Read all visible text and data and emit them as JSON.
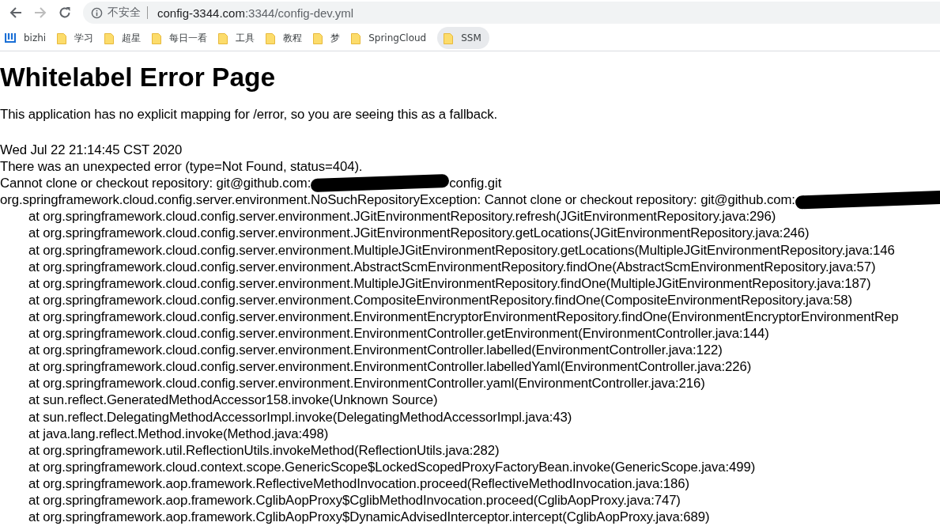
{
  "browser": {
    "back_disabled": false,
    "forward_disabled": true,
    "security_label": "不安全",
    "url_host": "config-3344.com",
    "url_path": ":3344/config-dev.yml"
  },
  "bookmarks": [
    {
      "label": "bizhi",
      "kind": "site",
      "selected": false
    },
    {
      "label": "学习",
      "kind": "folder",
      "selected": false
    },
    {
      "label": "超星",
      "kind": "folder",
      "selected": false
    },
    {
      "label": "每日一看",
      "kind": "folder",
      "selected": false
    },
    {
      "label": "工具",
      "kind": "folder",
      "selected": false
    },
    {
      "label": "教程",
      "kind": "folder",
      "selected": false
    },
    {
      "label": "梦",
      "kind": "folder",
      "selected": false
    },
    {
      "label": "SpringCloud",
      "kind": "folder",
      "selected": false
    },
    {
      "label": "SSM",
      "kind": "folder",
      "selected": true
    }
  ],
  "page": {
    "title": "Whitelabel Error Page",
    "message": "This application has no explicit mapping for /error, so you are seeing this as a fallback.",
    "lines": [
      {
        "text": "Wed Jul 22 21:14:45 CST 2020",
        "indented": false
      },
      {
        "text": "There was an unexpected error (type=Not Found, status=404).",
        "indented": false
      },
      {
        "text": "Cannot clone or checkout repository: git@github.com:",
        "indented": false,
        "redacted": true,
        "after": "config.git"
      },
      {
        "text": "org.springframework.cloud.config.server.environment.NoSuchRepositoryException: Cannot clone or checkout repository: git@github.com:",
        "indented": false,
        "redacted": true
      },
      {
        "text": "at org.springframework.cloud.config.server.environment.JGitEnvironmentRepository.refresh(JGitEnvironmentRepository.java:296)",
        "indented": true
      },
      {
        "text": "at org.springframework.cloud.config.server.environment.JGitEnvironmentRepository.getLocations(JGitEnvironmentRepository.java:246)",
        "indented": true
      },
      {
        "text": "at org.springframework.cloud.config.server.environment.MultipleJGitEnvironmentRepository.getLocations(MultipleJGitEnvironmentRepository.java:146",
        "indented": true
      },
      {
        "text": "at org.springframework.cloud.config.server.environment.AbstractScmEnvironmentRepository.findOne(AbstractScmEnvironmentRepository.java:57)",
        "indented": true
      },
      {
        "text": "at org.springframework.cloud.config.server.environment.MultipleJGitEnvironmentRepository.findOne(MultipleJGitEnvironmentRepository.java:187)",
        "indented": true
      },
      {
        "text": "at org.springframework.cloud.config.server.environment.CompositeEnvironmentRepository.findOne(CompositeEnvironmentRepository.java:58)",
        "indented": true
      },
      {
        "text": "at org.springframework.cloud.config.server.environment.EnvironmentEncryptorEnvironmentRepository.findOne(EnvironmentEncryptorEnvironmentRep",
        "indented": true
      },
      {
        "text": "at org.springframework.cloud.config.server.environment.EnvironmentController.getEnvironment(EnvironmentController.java:144)",
        "indented": true
      },
      {
        "text": "at org.springframework.cloud.config.server.environment.EnvironmentController.labelled(EnvironmentController.java:122)",
        "indented": true
      },
      {
        "text": "at org.springframework.cloud.config.server.environment.EnvironmentController.labelledYaml(EnvironmentController.java:226)",
        "indented": true
      },
      {
        "text": "at org.springframework.cloud.config.server.environment.EnvironmentController.yaml(EnvironmentController.java:216)",
        "indented": true
      },
      {
        "text": "at sun.reflect.GeneratedMethodAccessor158.invoke(Unknown Source)",
        "indented": true
      },
      {
        "text": "at sun.reflect.DelegatingMethodAccessorImpl.invoke(DelegatingMethodAccessorImpl.java:43)",
        "indented": true
      },
      {
        "text": "at java.lang.reflect.Method.invoke(Method.java:498)",
        "indented": true
      },
      {
        "text": "at org.springframework.util.ReflectionUtils.invokeMethod(ReflectionUtils.java:282)",
        "indented": true
      },
      {
        "text": "at org.springframework.cloud.context.scope.GenericScope$LockedScopedProxyFactoryBean.invoke(GenericScope.java:499)",
        "indented": true
      },
      {
        "text": "at org.springframework.aop.framework.ReflectiveMethodInvocation.proceed(ReflectiveMethodInvocation.java:186)",
        "indented": true
      },
      {
        "text": "at org.springframework.aop.framework.CglibAopProxy$CglibMethodInvocation.proceed(CglibAopProxy.java:747)",
        "indented": true
      },
      {
        "text": "at org.springframework.aop.framework.CglibAopProxy$DynamicAdvisedInterceptor.intercept(CglibAopProxy.java:689)",
        "indented": true
      }
    ]
  }
}
